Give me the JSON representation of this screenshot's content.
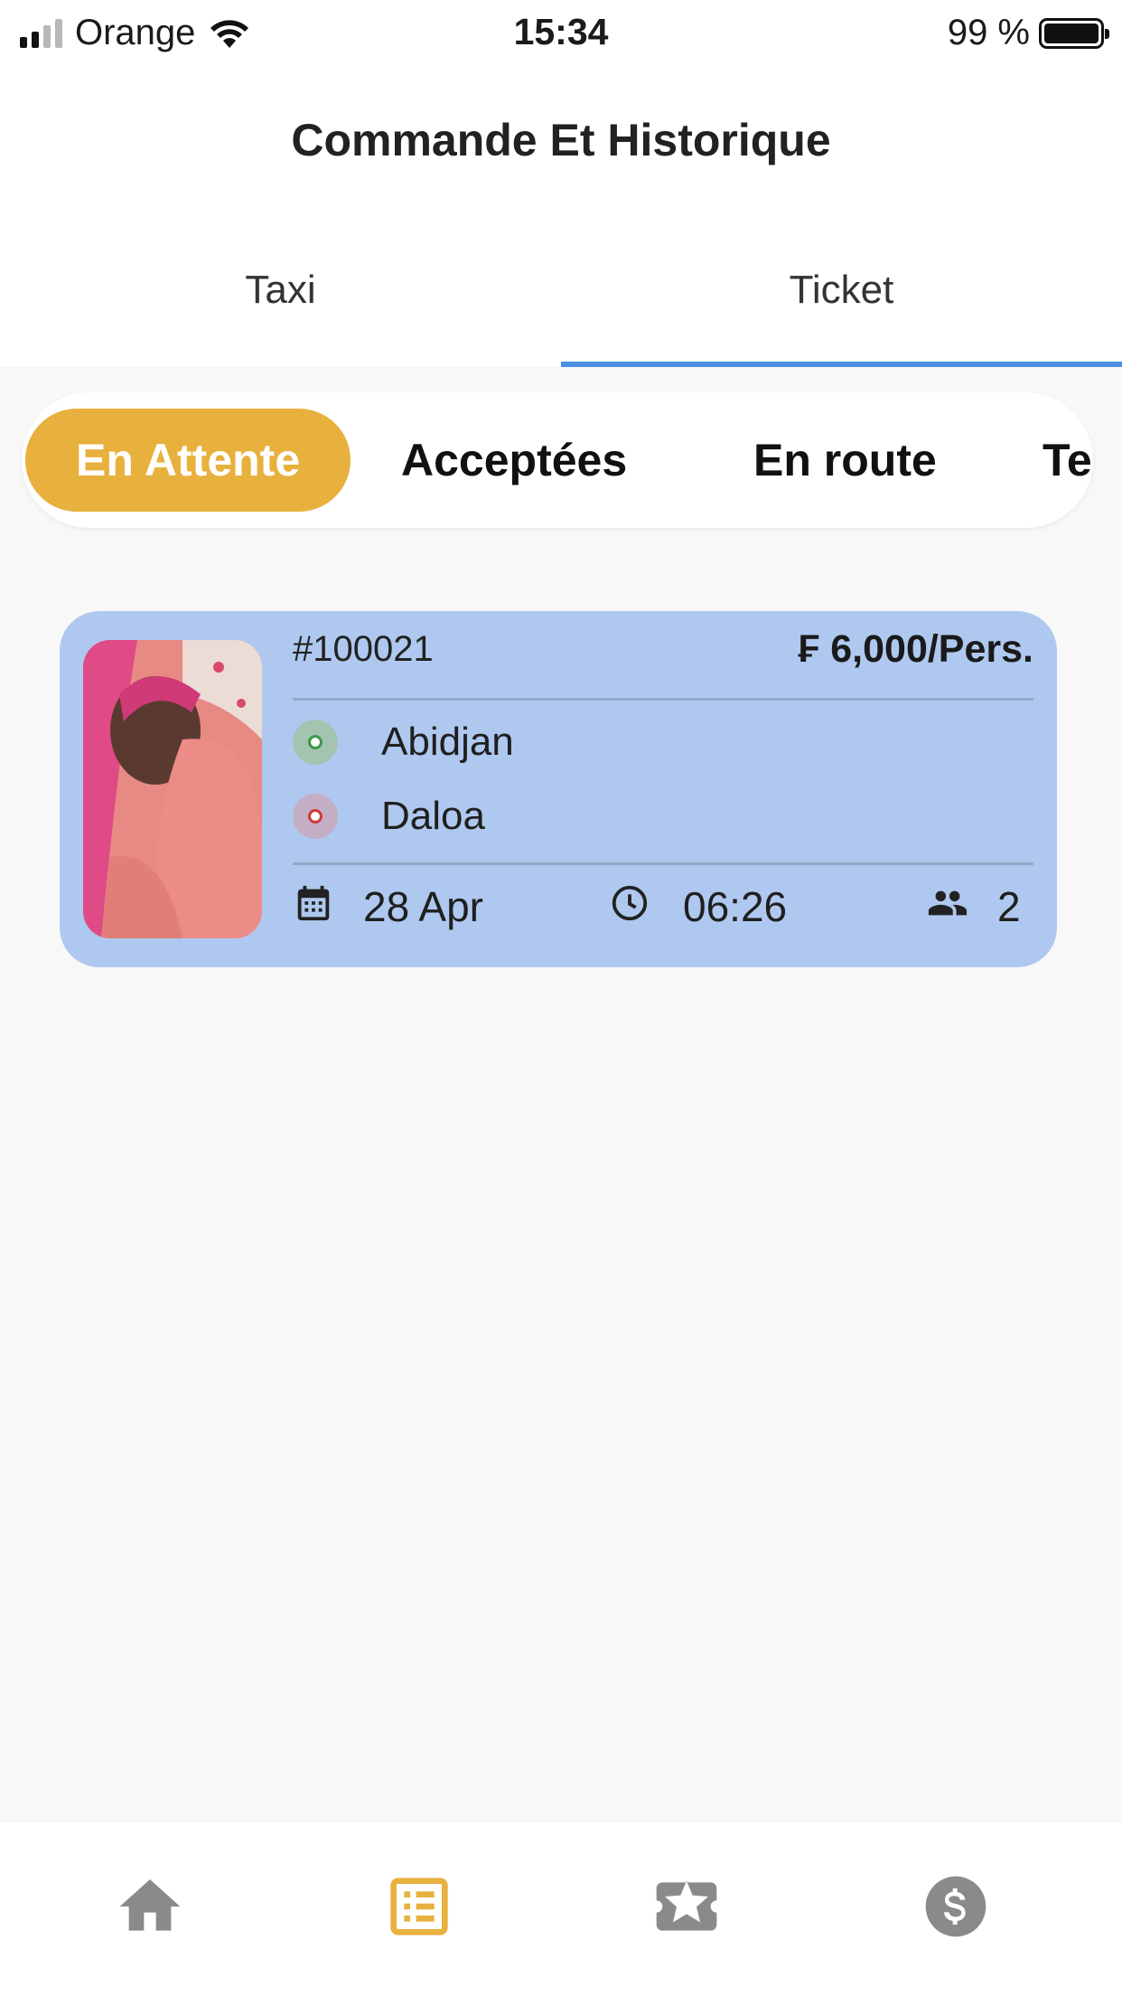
{
  "status_bar": {
    "carrier": "Orange",
    "time": "15:34",
    "battery": "99 %"
  },
  "header": {
    "title": "Commande Et Historique"
  },
  "tabs": [
    {
      "label": "Taxi",
      "active": false
    },
    {
      "label": "Ticket",
      "active": true
    }
  ],
  "filters": [
    {
      "label": "En Attente",
      "active": true
    },
    {
      "label": "Acceptées",
      "active": false
    },
    {
      "label": "En route",
      "active": false
    },
    {
      "label": "Te",
      "active": false
    }
  ],
  "orders": [
    {
      "id": "#100021",
      "price": "₣ 6,000/Pers.",
      "from": "Abidjan",
      "to": "Daloa",
      "date": "28 Apr",
      "time": "06:26",
      "passengers": "2"
    }
  ],
  "colors": {
    "accent": "#e8b03c",
    "tab_indicator": "#4a90e2",
    "card_bg": "#afc8ef",
    "nav_inactive": "#8a8a8a"
  },
  "bottom_nav": [
    {
      "icon": "home-icon",
      "active": false
    },
    {
      "icon": "list-icon",
      "active": true
    },
    {
      "icon": "ticket-icon",
      "active": false
    },
    {
      "icon": "dollar-icon",
      "active": false
    }
  ]
}
